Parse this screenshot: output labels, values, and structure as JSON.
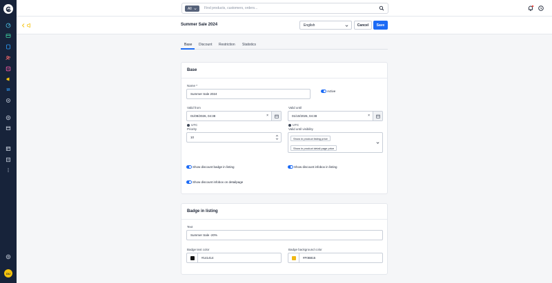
{
  "colors": {
    "accent": "#1C6BF5",
    "sidebar": "#17233A",
    "badge_text": "#141414",
    "badge_background": "#F0B815",
    "avatar": "#F4C20D"
  },
  "sidebar": {
    "icons": [
      "logo-icon",
      "dashboard-icon",
      "catalog-icon",
      "orders-icon",
      "customers-icon",
      "content-icon",
      "marketing-icon",
      "extensions-icon",
      "settings-icon",
      "sales-channel-add-icon",
      "storefront-icon",
      "sales-channels-icon",
      "headless-icon",
      "more-icon",
      "help-icon"
    ],
    "avatar_initials": "DU"
  },
  "topbar": {
    "search_scope": "All",
    "search_placeholder": "Find products, customers, orders...",
    "icons": [
      "notifications-icon",
      "help-circle-icon"
    ]
  },
  "header": {
    "title": "Summer Sale 2024",
    "language": "English",
    "cancel_label": "Cancel",
    "save_label": "Save"
  },
  "tabs": [
    {
      "label": "Base",
      "active": true
    },
    {
      "label": "Discount",
      "active": false
    },
    {
      "label": "Restriction",
      "active": false
    },
    {
      "label": "Statistics",
      "active": false
    }
  ],
  "base": {
    "title": "Base",
    "name_label": "Name *",
    "name_value": "Summer Sale 2024",
    "active_label": "Active",
    "valid_from_label": "Valid from",
    "valid_from_value": "01/09/2026, 04:38",
    "valid_until_label": "Valid until",
    "valid_until_value": "01/10/2026, 04:38",
    "utc_label": "UTC",
    "clear_symbol": "×",
    "priority_label": "Priority",
    "priority_value": "10",
    "visibility_label": "Valid until visibility",
    "visibility_chips": [
      "Show in product listing price",
      "Show in product detail page price"
    ],
    "toggles": {
      "badge_listing": "Show discount badge in listing",
      "infobox_listing": "Show discount infobox in listing",
      "infobox_detail": "Show discount infobox on detailpage"
    }
  },
  "badge": {
    "title": "Badge in listing",
    "text_label": "Text",
    "text_value": "Summer Sale -20%",
    "text_color_label": "Badge text color",
    "text_color_value": "#141414",
    "bg_color_label": "Badge background color",
    "bg_color_value": "#F0B815"
  }
}
